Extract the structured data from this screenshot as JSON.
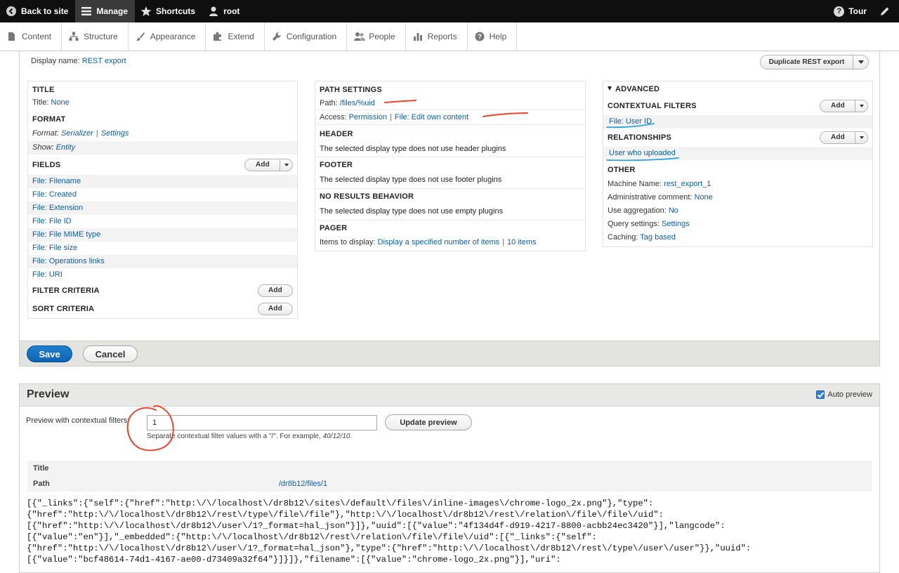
{
  "toolbar": {
    "back_to_site": "Back to site",
    "manage": "Manage",
    "shortcuts": "Shortcuts",
    "user": "root",
    "tour": "Tour"
  },
  "tray": {
    "items": [
      "Content",
      "Structure",
      "Appearance",
      "Extend",
      "Configuration",
      "People",
      "Reports",
      "Help"
    ]
  },
  "display": {
    "label": "Display name:",
    "name": "REST export",
    "duplicate_button": "Duplicate REST export"
  },
  "col1": {
    "title_head": "TITLE",
    "title_label": "Title:",
    "title_value": "None",
    "format_head": "FORMAT",
    "format_label": "Format:",
    "format_value": "Serializer",
    "format_settings": "Settings",
    "show_label": "Show:",
    "show_value": "Entity",
    "fields_head": "FIELDS",
    "add_label": "Add",
    "fields": [
      "File: Filename",
      "File: Created",
      "File: Extension",
      "File: File ID",
      "File: File MIME type",
      "File: File size",
      "File: Operations links",
      "File: URI"
    ],
    "filter_head": "FILTER CRITERIA",
    "sort_head": "SORT CRITERIA"
  },
  "col2": {
    "path_head": "PATH SETTINGS",
    "path_label": "Path:",
    "path_value": "/files/%uid",
    "access_label": "Access:",
    "access_value": "Permission",
    "access_perm": "File: Edit own content",
    "header_head": "HEADER",
    "header_text": "The selected display type does not use header plugins",
    "footer_head": "FOOTER",
    "footer_text": "The selected display type does not use footer plugins",
    "noresults_head": "NO RESULTS BEHAVIOR",
    "noresults_text": "The selected display type does not use empty plugins",
    "pager_head": "PAGER",
    "pager_label": "Items to display:",
    "pager_value": "Display a specified number of items",
    "pager_count": "10 items"
  },
  "col3": {
    "advanced_head": "ADVANCED",
    "contextual_head": "CONTEXTUAL FILTERS",
    "contextual_value": "File: User ID",
    "relationships_head": "RELATIONSHIPS",
    "relationships_value": "User who uploaded",
    "other_head": "OTHER",
    "machine_label": "Machine Name:",
    "machine_value": "rest_export_1",
    "admin_label": "Administrative comment:",
    "admin_value": "None",
    "agg_label": "Use aggregation:",
    "agg_value": "No",
    "query_label": "Query settings:",
    "query_value": "Settings",
    "caching_label": "Caching:",
    "caching_value": "Tag based",
    "add_label": "Add"
  },
  "actions": {
    "save": "Save",
    "cancel": "Cancel"
  },
  "preview": {
    "title": "Preview",
    "auto_preview": "Auto preview",
    "contextual_label": "Preview with contextual filters:",
    "contextual_value": "1",
    "update_button": "Update preview",
    "desc_prefix": "Separate contextual filter values with a \"/\". For example, ",
    "desc_example": "40/12/10",
    "desc_suffix": ".",
    "table_title_head": "Title",
    "table_path_head": "Path",
    "table_path_value": "/dr8b12/files/1",
    "json_lines": [
      "[{\"_links\":{\"self\":{\"href\":\"http:\\/\\/localhost\\/dr8b12\\/sites\\/default\\/files\\/inline-images\\/chrome-logo_2x.png\"},\"type\":",
      "{\"href\":\"http:\\/\\/localhost\\/dr8b12\\/rest\\/type\\/file\\/file\"},\"http:\\/\\/localhost\\/dr8b12\\/rest\\/relation\\/file\\/file\\/uid\":",
      "[{\"href\":\"http:\\/\\/localhost\\/dr8b12\\/user\\/1?_format=hal_json\"}]},\"uuid\":[{\"value\":\"4f134d4f-d919-4217-8800-acbb24ec3420\"}],\"langcode\":",
      "[{\"value\":\"en\"}],\"_embedded\":{\"http:\\/\\/localhost\\/dr8b12\\/rest\\/relation\\/file\\/file\\/uid\":[{\"_links\":{\"self\":",
      "{\"href\":\"http:\\/\\/localhost\\/dr8b12\\/user\\/1?_format=hal_json\"},\"type\":{\"href\":\"http:\\/\\/localhost\\/dr8b12\\/rest\\/type\\/user\\/user\"}},\"uuid\":",
      "[{\"value\":\"bcf48614-74d1-4167-ae00-d73409a32f64\"}]}]},\"filename\":[{\"value\":\"chrome-logo_2x.png\"}],\"uri\":"
    ]
  },
  "colors": {
    "link": "#0b5ea8",
    "primary": "#1470c2",
    "annotation_red": "#e8452c",
    "annotation_blue": "#2aa3d8"
  }
}
